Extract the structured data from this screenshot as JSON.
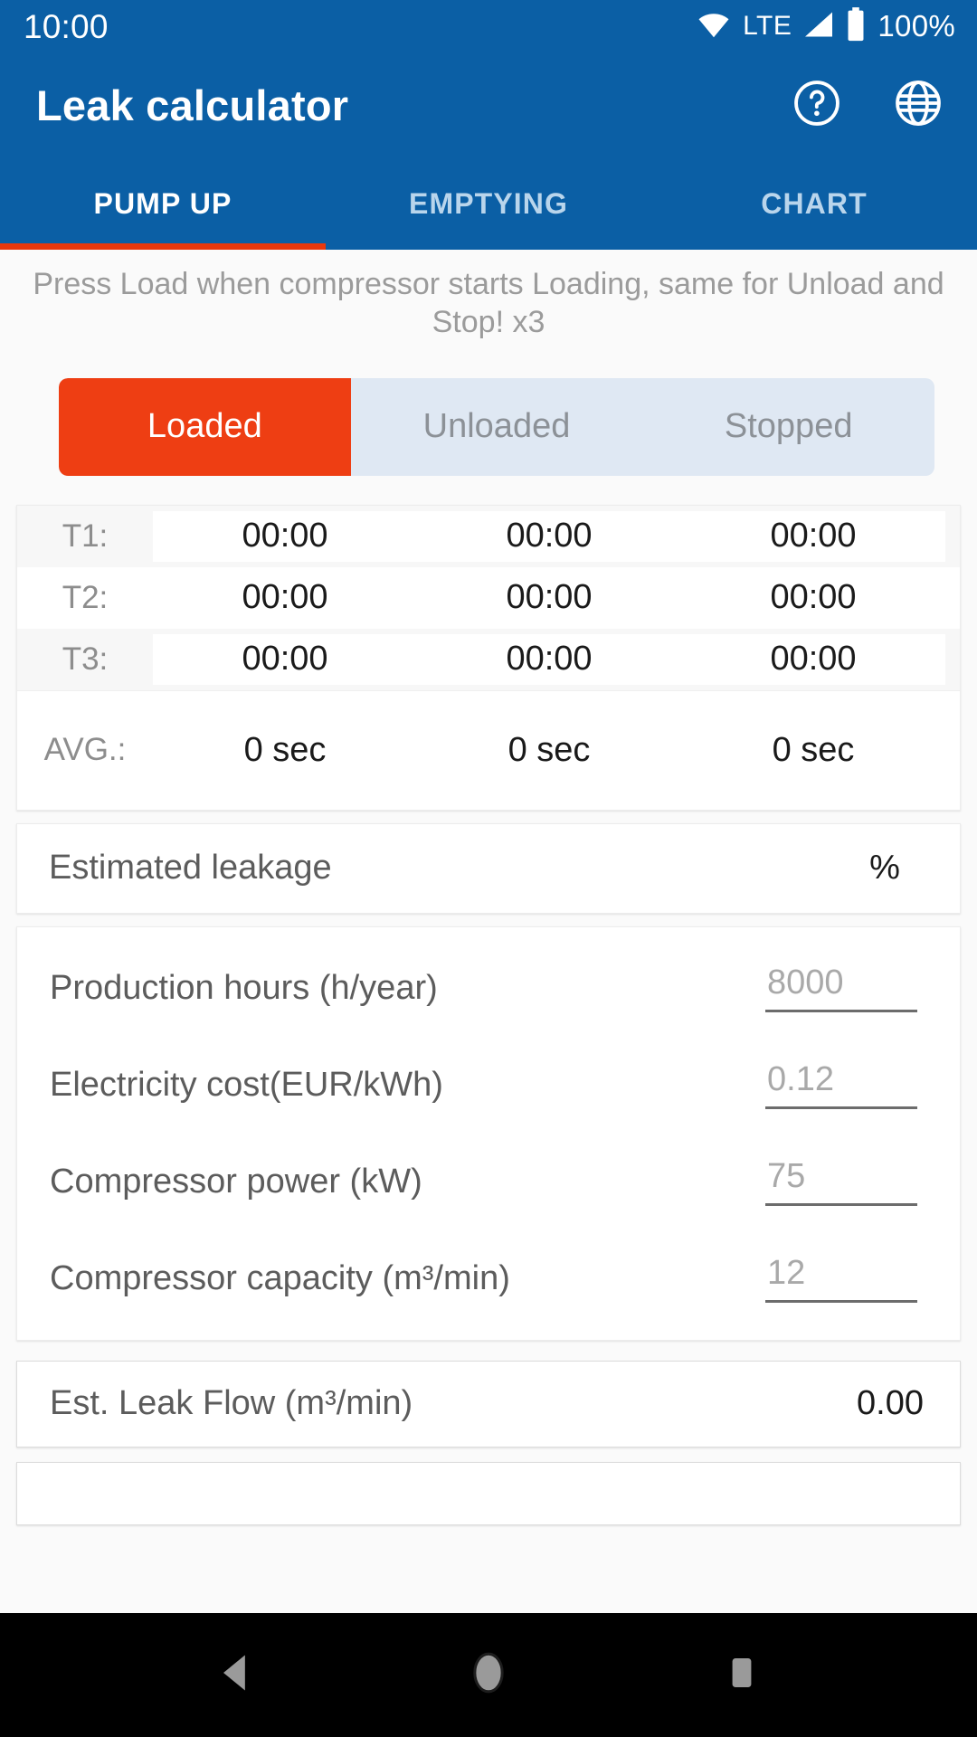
{
  "status_bar": {
    "time": "10:00",
    "network_label": "LTE",
    "battery_label": "100%",
    "icons": [
      "wifi-icon",
      "signal-icon",
      "battery-icon"
    ]
  },
  "app_bar": {
    "title": "Leak calculator",
    "actions": [
      {
        "name": "help-icon",
        "label": "Help"
      },
      {
        "name": "language-globe-icon",
        "label": "Language"
      }
    ],
    "background_color": "#0b5fa5"
  },
  "tabs": {
    "items": [
      {
        "label": "PUMP UP",
        "active": true
      },
      {
        "label": "EMPTYING",
        "active": false
      },
      {
        "label": "CHART",
        "active": false
      }
    ],
    "indicator_color": "#e8380d"
  },
  "main": {
    "hint": "Press Load when compressor starts Loading, same for Unload and Stop!  x3",
    "segmented": {
      "options": [
        {
          "label": "Loaded",
          "active": true
        },
        {
          "label": "Unloaded",
          "active": false
        },
        {
          "label": "Stopped",
          "active": false
        }
      ],
      "active_color": "#ee3e13",
      "track_color": "#dfe8f3"
    },
    "times_table": {
      "rows": [
        {
          "label": "T1:",
          "values": [
            "00:00",
            "00:00",
            "00:00"
          ]
        },
        {
          "label": "T2:",
          "values": [
            "00:00",
            "00:00",
            "00:00"
          ]
        },
        {
          "label": "T3:",
          "values": [
            "00:00",
            "00:00",
            "00:00"
          ]
        }
      ],
      "average": {
        "label": "AVG.:",
        "values": [
          "0 sec",
          "0 sec",
          "0 sec"
        ]
      }
    },
    "estimated_leakage": {
      "label": "Estimated leakage",
      "value": "",
      "unit": "%"
    },
    "inputs": [
      {
        "label": "Production hours (h/year)",
        "value": "",
        "placeholder": "8000"
      },
      {
        "label": "Electricity cost(EUR/kWh)",
        "value": "",
        "placeholder": "0.12"
      },
      {
        "label": "Compressor power (kW)",
        "value": "",
        "placeholder": "75"
      },
      {
        "label": "Compressor capacity (m³/min)",
        "value": "",
        "placeholder": "12"
      }
    ],
    "est_leak_flow": {
      "label": "Est. Leak Flow (m³/min)",
      "value": "0.00"
    }
  },
  "nav_bar": {
    "buttons": [
      {
        "name": "back-button",
        "label": "Back"
      },
      {
        "name": "home-button",
        "label": "Home"
      },
      {
        "name": "recents-button",
        "label": "Recents"
      }
    ]
  }
}
